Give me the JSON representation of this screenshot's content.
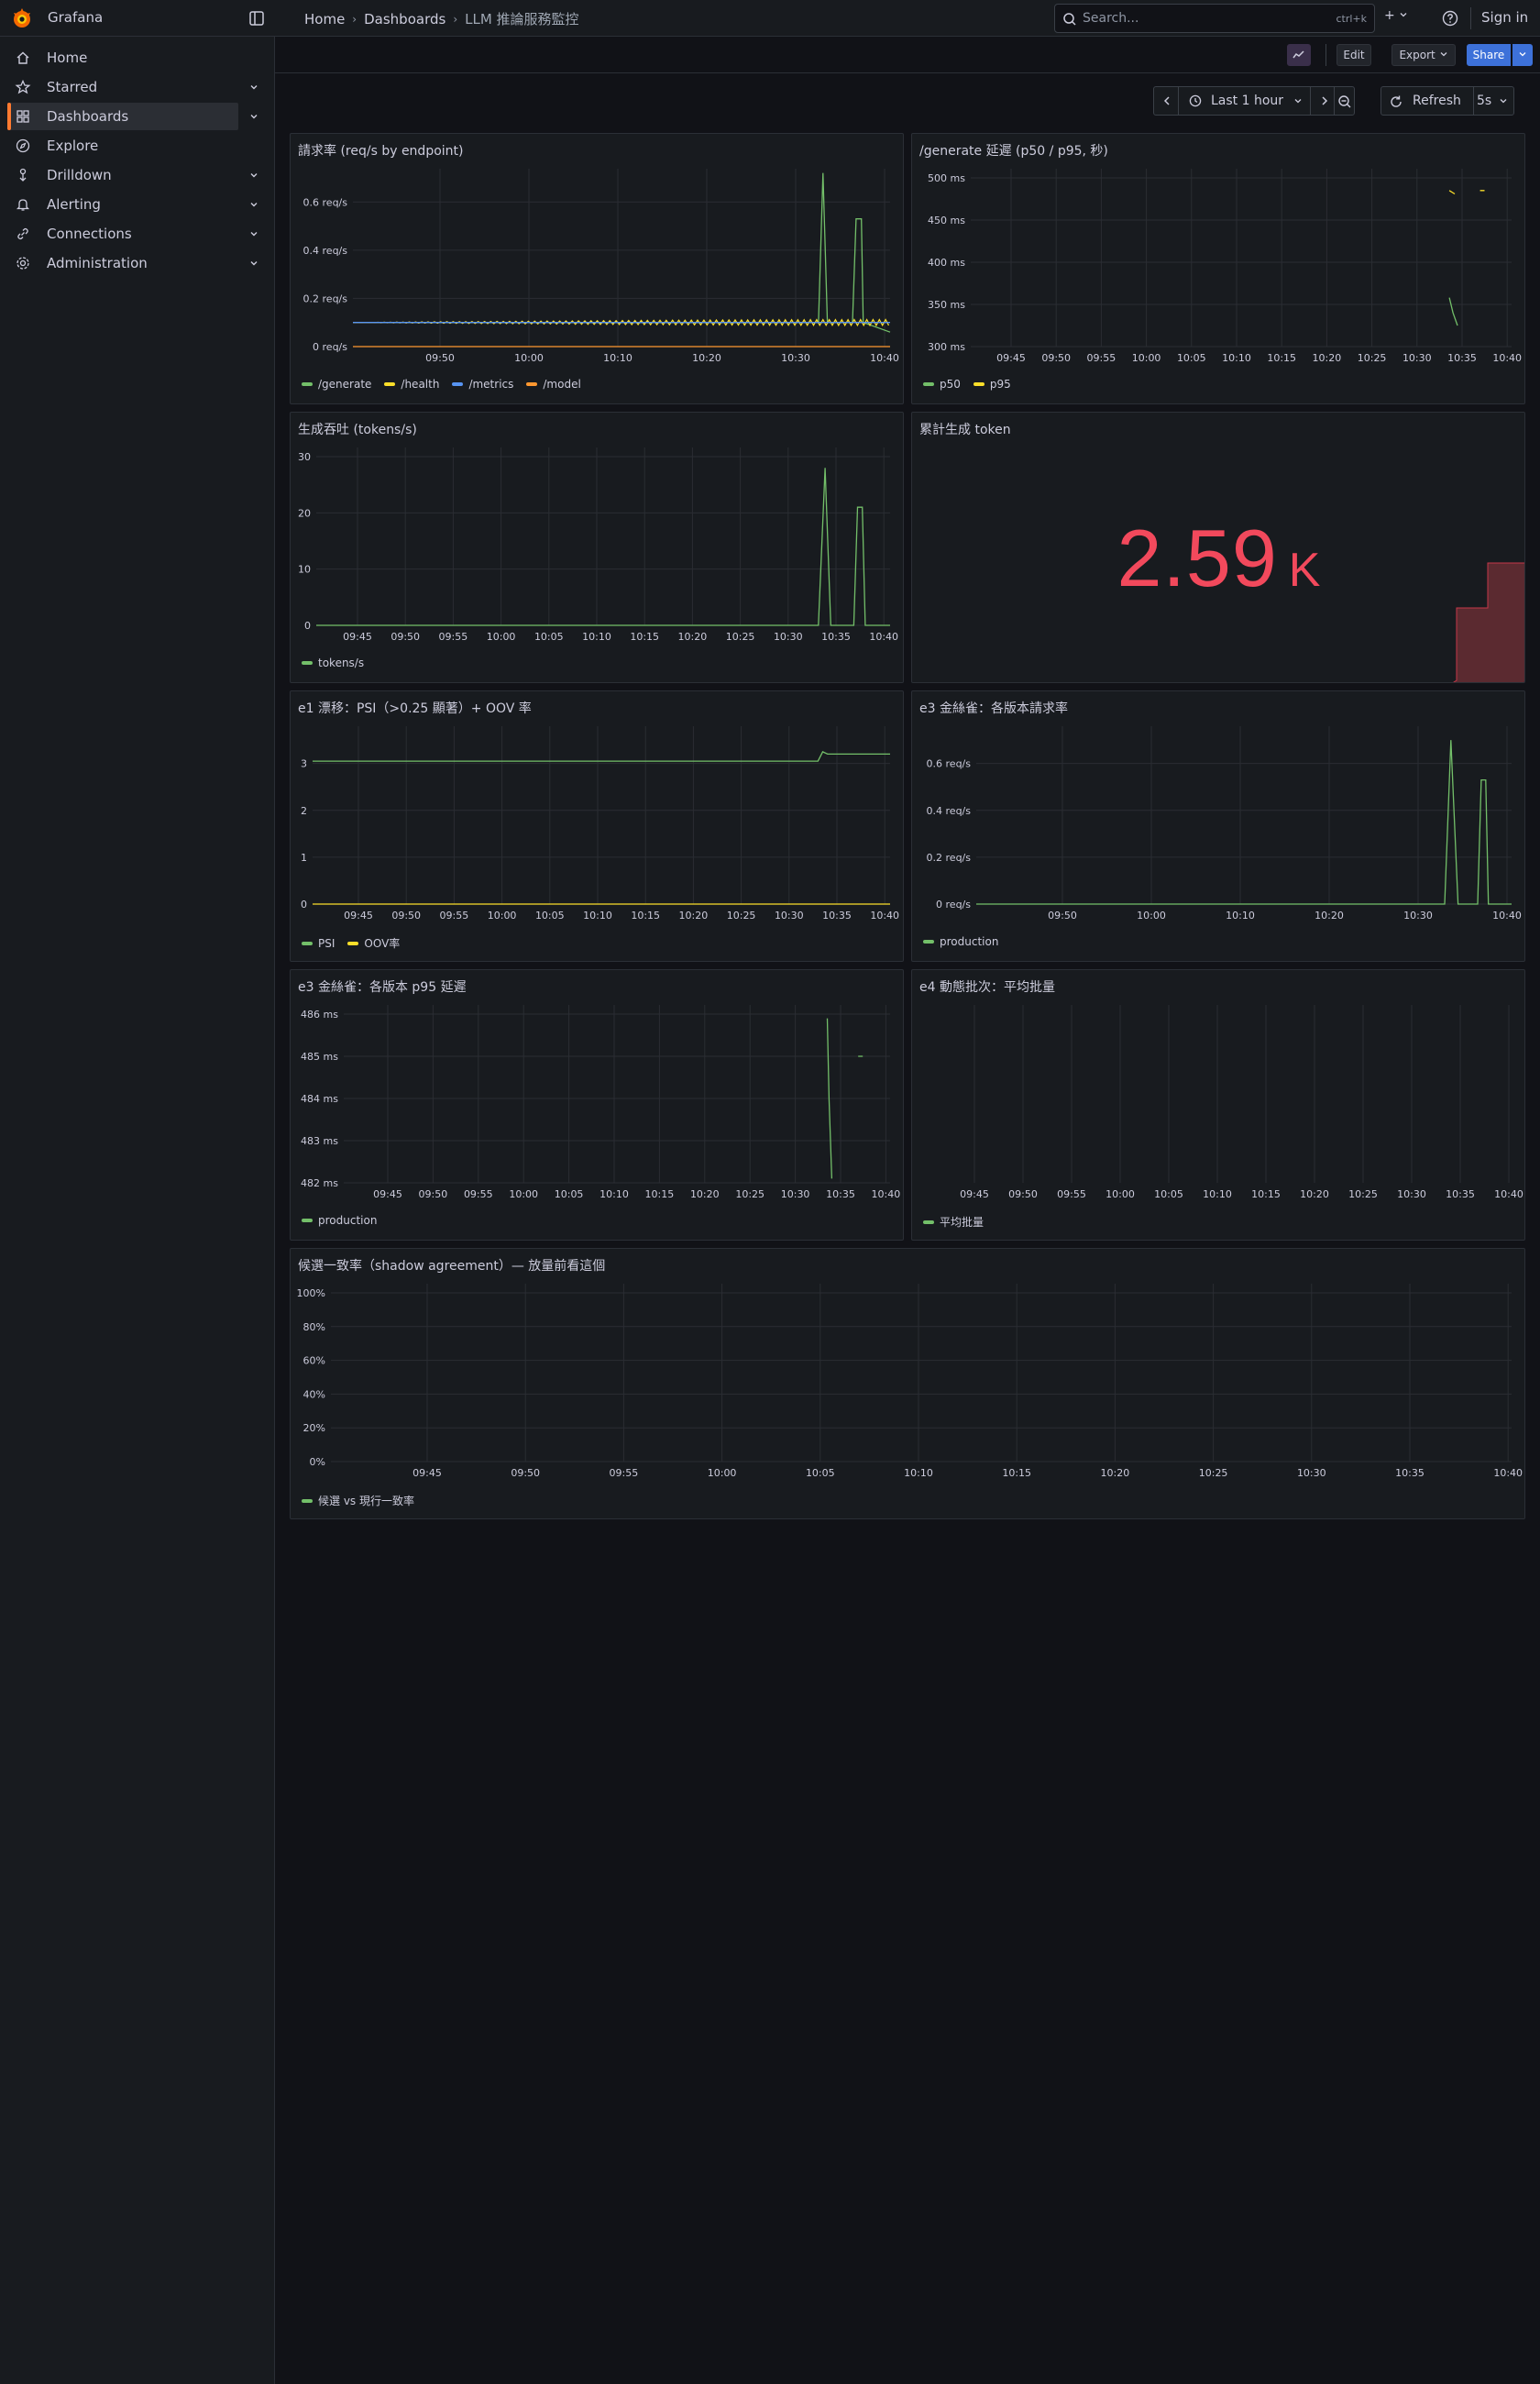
{
  "app": {
    "title": "Grafana"
  },
  "breadcrumb": [
    "Home",
    "Dashboards",
    "LLM 推論服務監控"
  ],
  "search": {
    "placeholder": "Search...",
    "shortcut": "ctrl+k"
  },
  "topbar": {
    "sign_in": "Sign in",
    "plus": "+"
  },
  "nav": {
    "items": [
      {
        "label": "Home",
        "icon": "home-icon",
        "chevron": false,
        "active": false
      },
      {
        "label": "Starred",
        "icon": "star-icon",
        "chevron": true,
        "active": false
      },
      {
        "label": "Dashboards",
        "icon": "apps-icon",
        "chevron": true,
        "active": true
      },
      {
        "label": "Explore",
        "icon": "compass-icon",
        "chevron": false,
        "active": false
      },
      {
        "label": "Drilldown",
        "icon": "drilldown-icon",
        "chevron": true,
        "active": false
      },
      {
        "label": "Alerting",
        "icon": "bell-icon",
        "chevron": true,
        "active": false
      },
      {
        "label": "Connections",
        "icon": "link-icon",
        "chevron": true,
        "active": false
      },
      {
        "label": "Administration",
        "icon": "gear-icon",
        "chevron": true,
        "active": false
      }
    ]
  },
  "toolbar": {
    "edit": "Edit",
    "export": "Export",
    "share": "Share"
  },
  "timepicker": {
    "range": "Last 1 hour",
    "refresh": "Refresh",
    "interval": "5s"
  },
  "colors": {
    "green": "#73bf69",
    "yellow": "#fade2a",
    "blue": "#5794f2",
    "orange": "#ff9830",
    "red": "#f2495c",
    "accent": "#ff7a30"
  },
  "panels": {
    "p1": {
      "title": "請求率 (req/s by endpoint)",
      "legend": [
        "/generate",
        "/health",
        "/metrics",
        "/model"
      ]
    },
    "p2": {
      "title": "/generate 延遲 (p50 / p95, 秒)",
      "legend": [
        "p50",
        "p95"
      ]
    },
    "p3": {
      "title": "生成吞吐 (tokens/s)",
      "legend": [
        "tokens/s"
      ]
    },
    "p4": {
      "title": "累計生成 token",
      "value": "2.59",
      "unit": "K"
    },
    "p5": {
      "title": "e1 漂移：PSI（>0.25 顯著）+ OOV 率",
      "legend": [
        "PSI",
        "OOV率"
      ]
    },
    "p6": {
      "title": "e3 金絲雀：各版本請求率",
      "legend": [
        "production"
      ]
    },
    "p7": {
      "title": "e3 金絲雀：各版本 p95 延遲",
      "legend": [
        "production"
      ]
    },
    "p8": {
      "title": "e4 動態批次：平均批量",
      "legend": [
        "平均批量"
      ]
    },
    "p9": {
      "title": "候選一致率（shadow agreement）— 放量前看這個",
      "legend": [
        "候選 vs 現行一致率"
      ]
    }
  },
  "chart_data": [
    {
      "type": "line",
      "title": "請求率 (req/s by endpoint)",
      "x_ticks": [
        "09:50",
        "10:00",
        "10:10",
        "10:20",
        "10:30",
        "10:40"
      ],
      "y_ticks": [
        "0 req/s",
        "0.2 req/s",
        "0.4 req/s",
        "0.6 req/s"
      ],
      "xlim": [
        0,
        60
      ],
      "ylim": [
        0,
        0.7
      ],
      "series": [
        {
          "name": "/generate",
          "points": [
            [
              0,
              0.1
            ],
            [
              51,
              0.1
            ],
            [
              52,
              0.1
            ],
            [
              52.5,
              0.72
            ],
            [
              53,
              0.1
            ],
            [
              55.8,
              0.1
            ],
            [
              56.2,
              0.53
            ],
            [
              56.8,
              0.53
            ],
            [
              57,
              0.1
            ],
            [
              60,
              0.06
            ]
          ]
        },
        {
          "name": "/health",
          "points": [
            [
              0,
              0.1
            ],
            [
              60,
              0.1
            ]
          ],
          "wavy": true
        },
        {
          "name": "/metrics",
          "points": [
            [
              0,
              0.1
            ],
            [
              60,
              0.1
            ]
          ]
        },
        {
          "name": "/model",
          "points": [
            [
              0,
              0.0
            ],
            [
              60,
              0.0
            ]
          ]
        }
      ]
    },
    {
      "type": "line",
      "title": "/generate 延遲 (p50 / p95, 秒)",
      "x_ticks": [
        "09:45",
        "09:50",
        "09:55",
        "10:00",
        "10:05",
        "10:10",
        "10:15",
        "10:20",
        "10:25",
        "10:30",
        "10:35",
        "10:40"
      ],
      "y_ticks": [
        "300 ms",
        "350 ms",
        "400 ms",
        "450 ms",
        "500 ms"
      ],
      "ylim": [
        300,
        500
      ],
      "series": [
        {
          "name": "p50",
          "points": [
            [
              53.1,
              358
            ],
            [
              53.5,
              340
            ],
            [
              54,
              325
            ]
          ]
        },
        {
          "name": "p95",
          "points": [
            [
              53.1,
              485
            ],
            [
              53.7,
              481
            ],
            [
              56.5,
              485
            ],
            [
              57,
              485
            ]
          ]
        }
      ]
    },
    {
      "type": "line",
      "title": "生成吞吐 (tokens/s)",
      "x_ticks": [
        "09:45",
        "09:50",
        "09:55",
        "10:00",
        "10:05",
        "10:10",
        "10:15",
        "10:20",
        "10:25",
        "10:30",
        "10:35",
        "10:40"
      ],
      "y_ticks": [
        "0",
        "10",
        "20",
        "30"
      ],
      "ylim": [
        0,
        30
      ],
      "series": [
        {
          "name": "tokens/s",
          "points": [
            [
              0,
              0
            ],
            [
              52.5,
              0
            ],
            [
              53.2,
              28
            ],
            [
              53.8,
              0
            ],
            [
              56.2,
              0
            ],
            [
              56.6,
              21
            ],
            [
              57.1,
              21
            ],
            [
              57.4,
              0
            ],
            [
              60,
              0
            ]
          ]
        }
      ]
    },
    {
      "type": "line",
      "title": "e1 漂移：PSI（>0.25 顯著）+ OOV 率",
      "x_ticks": [
        "09:45",
        "09:50",
        "09:55",
        "10:00",
        "10:05",
        "10:10",
        "10:15",
        "10:20",
        "10:25",
        "10:30",
        "10:35",
        "10:40"
      ],
      "y_ticks": [
        "0",
        "1",
        "2",
        "3"
      ],
      "ylim": [
        0,
        3.6
      ],
      "series": [
        {
          "name": "PSI",
          "points": [
            [
              0,
              3.05
            ],
            [
              52.5,
              3.05
            ],
            [
              53,
              3.25
            ],
            [
              53.5,
              3.2
            ],
            [
              60,
              3.2
            ]
          ]
        },
        {
          "name": "OOV率",
          "points": [
            [
              0,
              0
            ],
            [
              60,
              0
            ]
          ]
        }
      ]
    },
    {
      "type": "line",
      "title": "e3 金絲雀：各版本請求率",
      "x_ticks": [
        "09:50",
        "10:00",
        "10:10",
        "10:20",
        "10:30",
        "10:40"
      ],
      "y_ticks": [
        "0 req/s",
        "0.2 req/s",
        "0.4 req/s",
        "0.6 req/s"
      ],
      "ylim": [
        0,
        0.72
      ],
      "series": [
        {
          "name": "production",
          "points": [
            [
              0,
              0
            ],
            [
              52.5,
              0
            ],
            [
              53.2,
              0.7
            ],
            [
              54,
              0
            ],
            [
              56.2,
              0
            ],
            [
              56.6,
              0.53
            ],
            [
              57.1,
              0.53
            ],
            [
              57.4,
              0
            ],
            [
              60,
              0
            ]
          ]
        }
      ]
    },
    {
      "type": "line",
      "title": "e3 金絲雀：各版本 p95 延遲",
      "x_ticks": [
        "09:45",
        "09:50",
        "09:55",
        "10:00",
        "10:05",
        "10:10",
        "10:15",
        "10:20",
        "10:25",
        "10:30",
        "10:35",
        "10:40"
      ],
      "y_ticks": [
        "482 ms",
        "483 ms",
        "484 ms",
        "485 ms",
        "486 ms"
      ],
      "ylim": [
        482,
        486
      ],
      "series": [
        {
          "name": "production",
          "points": [
            [
              53.1,
              485.9
            ],
            [
              53.3,
              484.0
            ],
            [
              53.6,
              482.1
            ],
            [
              56.5,
              485.0
            ],
            [
              57,
              485.0
            ]
          ]
        }
      ]
    },
    {
      "type": "line",
      "title": "e4 動態批次：平均批量",
      "x_ticks": [
        "09:45",
        "09:50",
        "09:55",
        "10:00",
        "10:05",
        "10:10",
        "10:15",
        "10:20",
        "10:25",
        "10:30",
        "10:35",
        "10:40"
      ],
      "series": [
        {
          "name": "平均批量",
          "points": []
        }
      ]
    },
    {
      "type": "line",
      "title": "候選一致率（shadow agreement）— 放量前看這個",
      "x_ticks": [
        "09:45",
        "09:50",
        "09:55",
        "10:00",
        "10:05",
        "10:10",
        "10:15",
        "10:20",
        "10:25",
        "10:30",
        "10:35",
        "10:40"
      ],
      "y_ticks": [
        "0%",
        "20%",
        "40%",
        "60%",
        "80%",
        "100%"
      ],
      "ylim": [
        0,
        100
      ],
      "series": [
        {
          "name": "候選 vs 現行一致率",
          "points": []
        }
      ]
    }
  ]
}
